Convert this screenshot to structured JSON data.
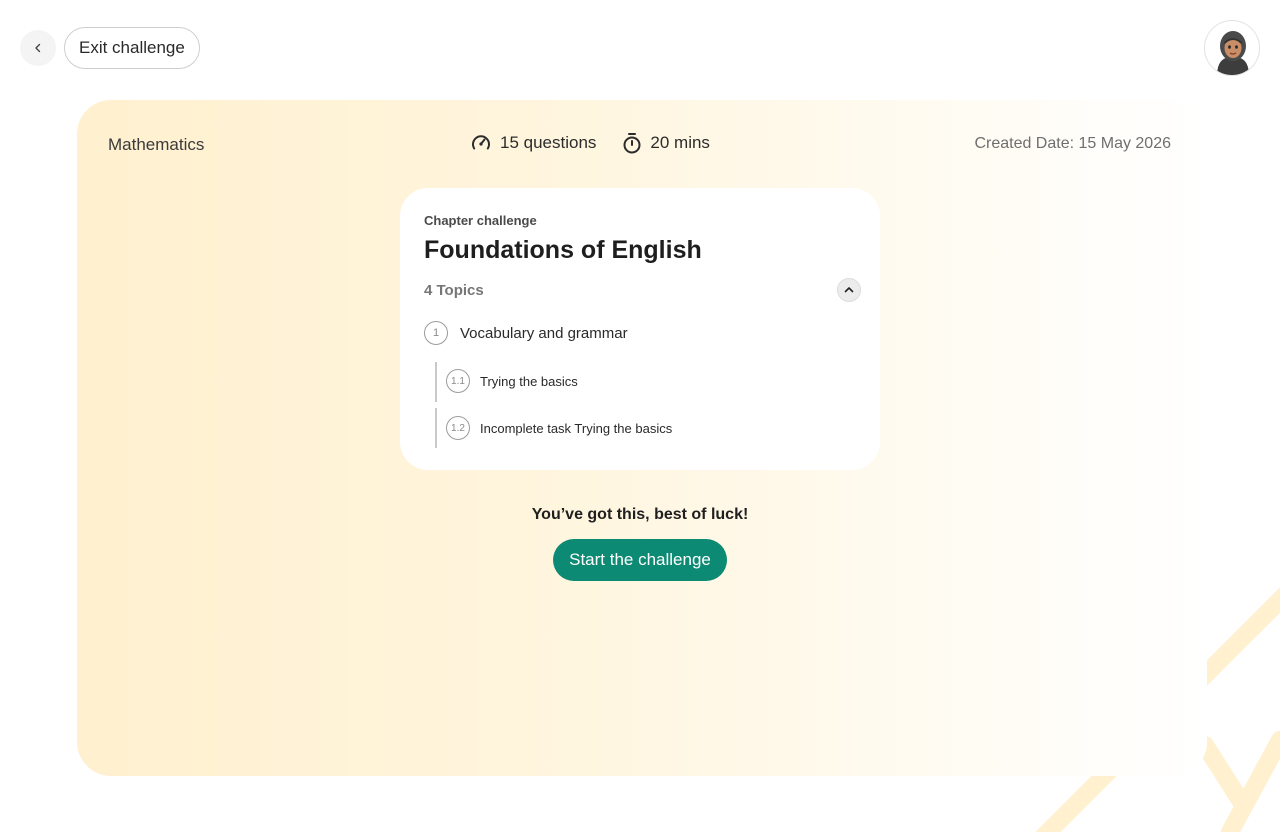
{
  "header": {
    "exit_label": "Exit challenge"
  },
  "challenge": {
    "subject": "Mathematics",
    "questions": "15 questions",
    "duration": "20 mins",
    "created": "Created Date: 15 May 2026",
    "kicker": "Chapter challenge",
    "title": "Foundations of English",
    "topics_count": "4 Topics",
    "topics": [
      {
        "number": "1",
        "label": "Vocabulary and grammar",
        "subtopics": [
          {
            "number": "1.1",
            "label": "Trying the basics"
          },
          {
            "number": "1.2",
            "label": "Incomplete task Trying the basics"
          }
        ]
      }
    ],
    "encouragement": "You’ve got this, best of luck!",
    "start_label": "Start the challenge"
  },
  "colors": {
    "accent": "#0d8a73",
    "card_gradient_start": "#fff0cf",
    "decoration": "#fff1cf"
  },
  "icons": {
    "back": "chevron-left-icon",
    "questions": "speedometer-icon",
    "duration": "stopwatch-icon",
    "collapse": "chevron-up-icon",
    "avatar": "user-avatar"
  }
}
